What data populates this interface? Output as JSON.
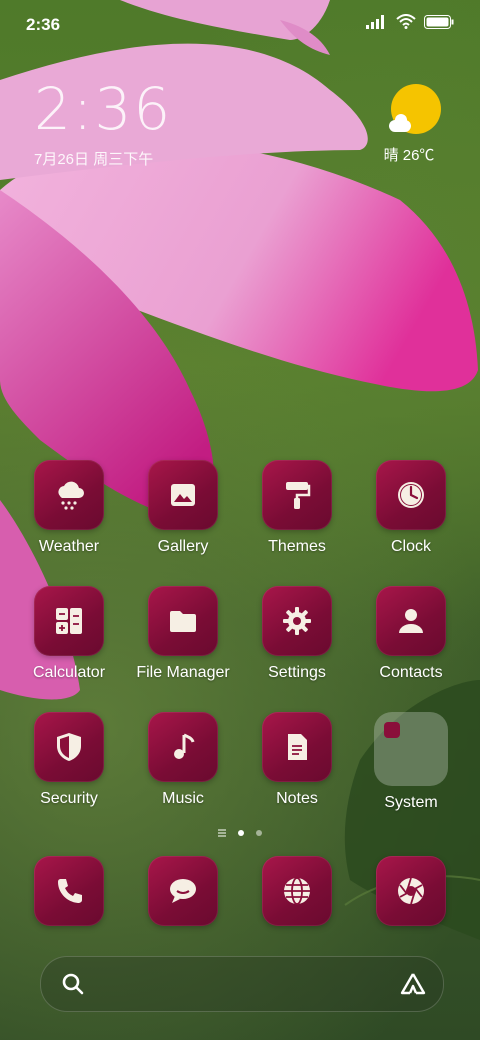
{
  "status_bar": {
    "time": "2:36"
  },
  "clock_widget": {
    "time": "2:36",
    "date": "7月26日 周三下午"
  },
  "weather_widget": {
    "text": "晴 26℃",
    "icon": "sunny-cloud-icon"
  },
  "apps": [
    {
      "label": "Weather",
      "icon": "weather-icon"
    },
    {
      "label": "Gallery",
      "icon": "gallery-icon"
    },
    {
      "label": "Themes",
      "icon": "paint-roller-icon"
    },
    {
      "label": "Clock",
      "icon": "clock-icon"
    },
    {
      "label": "Calculator",
      "icon": "calculator-icon"
    },
    {
      "label": "File Manager",
      "icon": "folder-icon"
    },
    {
      "label": "Settings",
      "icon": "gear-icon"
    },
    {
      "label": "Contacts",
      "icon": "person-icon"
    },
    {
      "label": "Security",
      "icon": "shield-icon"
    },
    {
      "label": "Music",
      "icon": "music-note-icon"
    },
    {
      "label": "Notes",
      "icon": "note-icon"
    },
    {
      "label": "System",
      "icon": "folder-icon"
    }
  ],
  "dock": [
    {
      "icon": "phone-icon"
    },
    {
      "icon": "message-icon"
    },
    {
      "icon": "browser-icon"
    },
    {
      "icon": "camera-icon"
    }
  ],
  "colors": {
    "icon_tile": "#8a0f3a",
    "glyph": "#f6efe4"
  }
}
